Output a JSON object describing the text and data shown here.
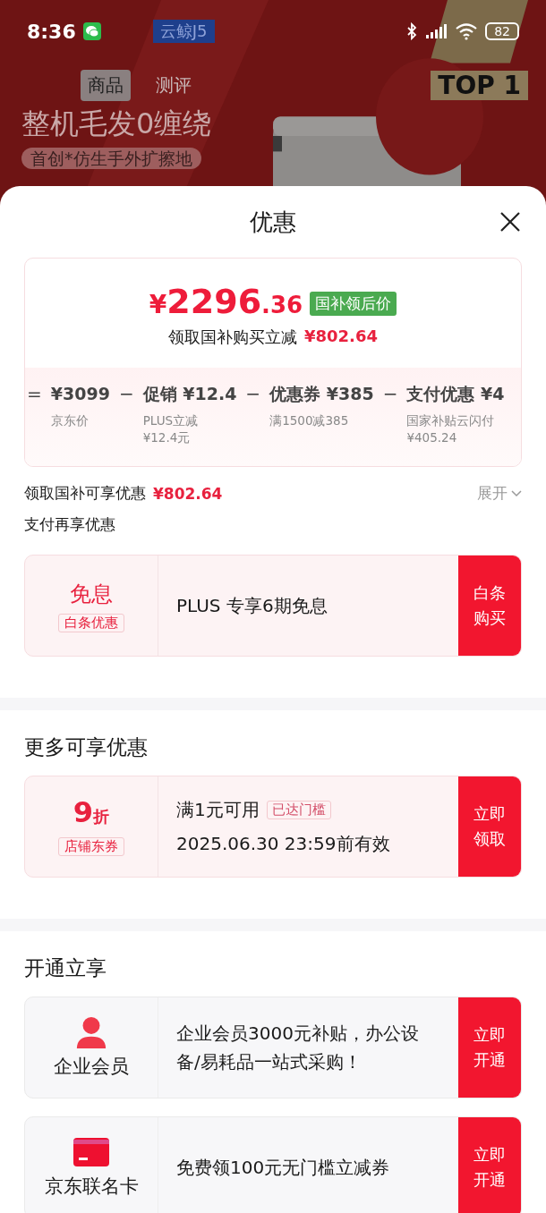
{
  "status_bar": {
    "time": "8:36",
    "battery": "82"
  },
  "background_page": {
    "model_badge": "云鲸J5",
    "tabs": [
      {
        "label": "商品",
        "selected": true
      },
      {
        "label": "测评",
        "selected": false
      }
    ],
    "headline": "整机毛发0缠绕",
    "chip": "首创*仿生手外扩擦地",
    "rank_badge": "TOP 1"
  },
  "sheet": {
    "title": "优惠",
    "price_card": {
      "currency": "¥",
      "price_int": "2296",
      "price_dec": ".36",
      "price_tag": "国补领后价",
      "saving_label": "领取国补购买立减",
      "saving_amount": "¥802.64",
      "breakdown": [
        {
          "operator": "=",
          "amount": "¥3099",
          "notes": [
            "京东价"
          ]
        },
        {
          "operator": "−",
          "label": "促销",
          "amount": "¥12.4",
          "notes": [
            "PLUS立减",
            "¥12.4元"
          ]
        },
        {
          "operator": "−",
          "label": "优惠券",
          "amount": "¥385",
          "notes": [
            "满1500减385"
          ]
        },
        {
          "operator": "−",
          "label": "支付优惠",
          "amount": "¥4",
          "notes": [
            "国家补贴云闪付",
            "¥405.24"
          ]
        }
      ]
    },
    "subsidy_row": {
      "label": "领取国补可享优惠",
      "amount": "¥802.64",
      "toggle": "展开",
      "expanded": false
    },
    "sections": [
      {
        "title": "支付再享优惠",
        "offers": [
          {
            "kind": "interest",
            "headline": "免息",
            "tag": "白条优惠",
            "text": "PLUS 专享6期免息",
            "action": "白条购买"
          }
        ]
      },
      {
        "title": "更多可享优惠",
        "offers": [
          {
            "kind": "coupon",
            "value": "9",
            "unit": "折",
            "tag": "店铺东券",
            "text": "满1元可用",
            "badge": "已达门槛",
            "validity": "2025.06.30 23:59前有效",
            "action": "立即领取"
          }
        ]
      },
      {
        "title": "开通立享",
        "offers": [
          {
            "kind": "member",
            "headline": "企业会员",
            "text": "企业会员3000元补贴，办公设备/易耗品一站式采购！",
            "action": "立即开通"
          },
          {
            "kind": "card",
            "headline": "京东联名卡",
            "text": "免费领100元无门槛立减券",
            "action": "立即开通"
          }
        ]
      }
    ]
  }
}
